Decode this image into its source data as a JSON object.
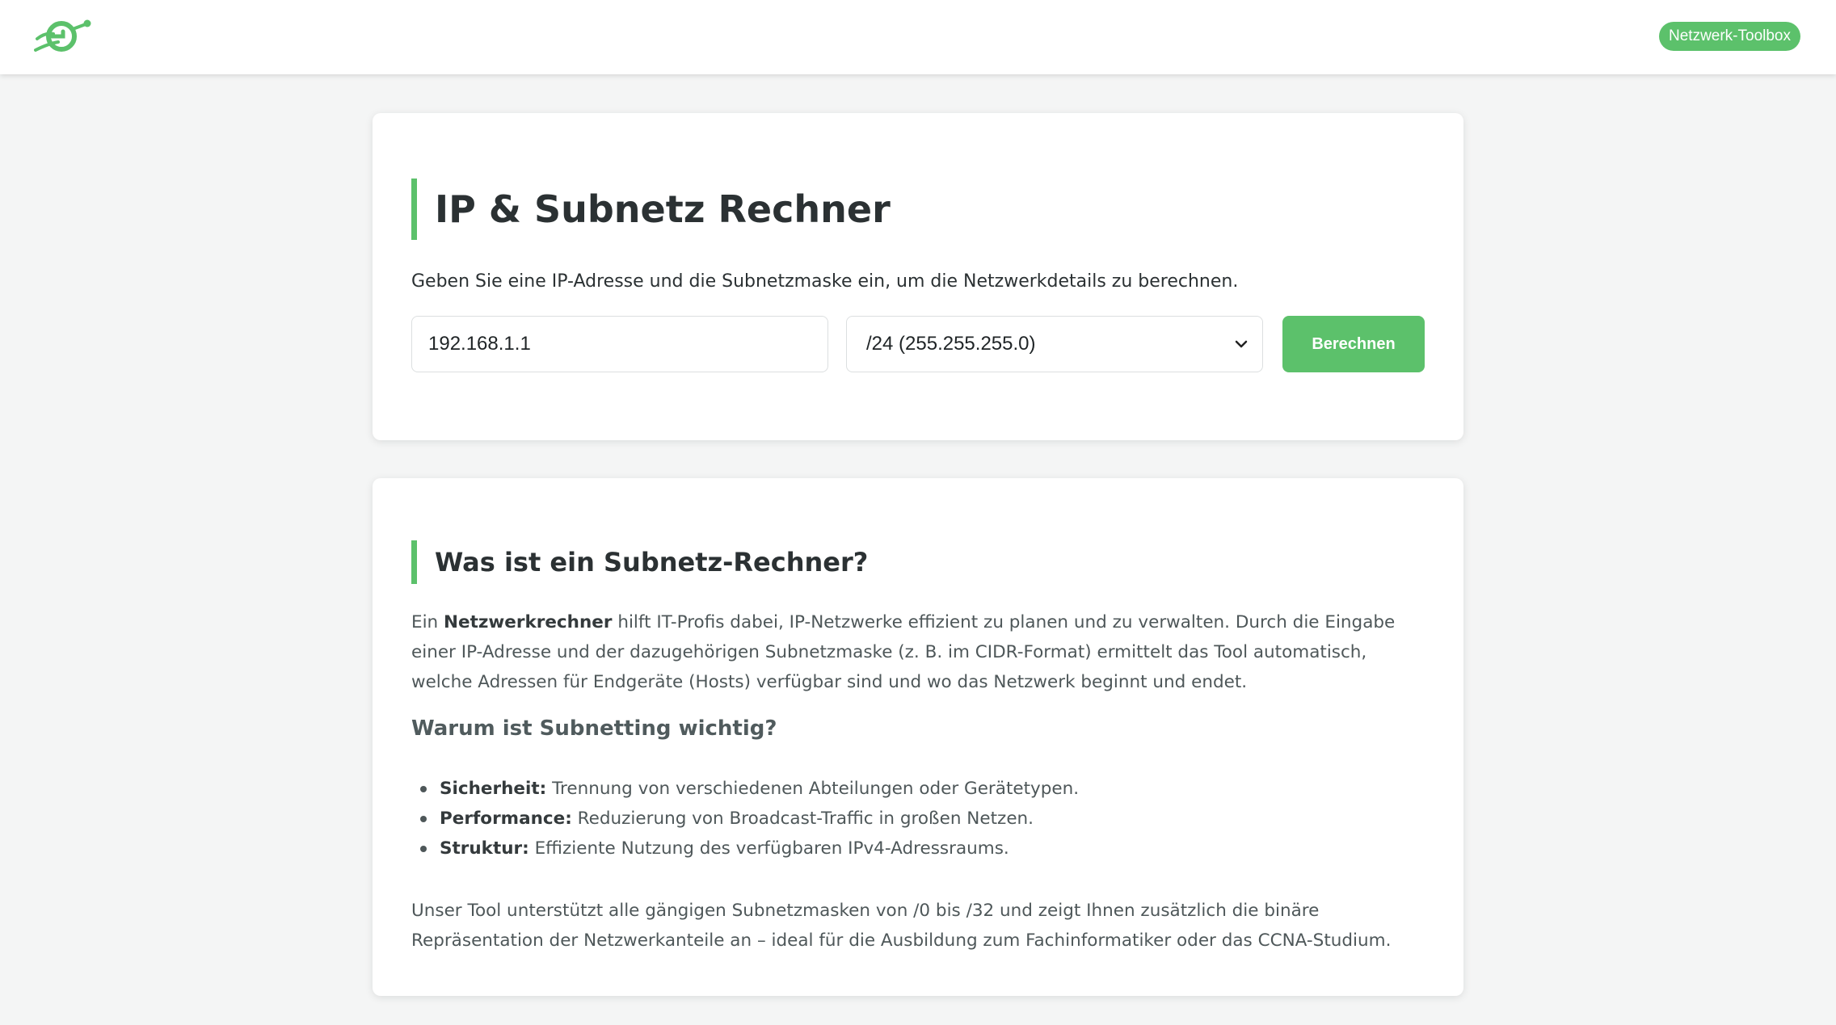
{
  "header": {
    "logo_icon": "network-target-logo",
    "badge_label": "Netzwerk-Toolbox"
  },
  "calculator": {
    "title": "IP & Subnetz Rechner",
    "description": "Geben Sie eine IP-Adresse und die Subnetzmaske ein, um die Netzwerkdetails zu berechnen.",
    "ip_value": "192.168.1.1",
    "cidr_selected": "/24 (255.255.255.0)",
    "calculate_label": "Berechnen"
  },
  "info": {
    "title": "Was ist ein Subnetz-Rechner?",
    "intro_prefix": "Ein ",
    "intro_bold": "Netzwerkrechner",
    "intro_rest": " hilft IT-Profis dabei, IP-Netzwerke effizient zu planen und zu verwalten. Durch die Eingabe einer IP-Adresse und der dazugehörigen Subnetzmaske (z. B. im CIDR-Format) ermittelt das Tool automatisch, welche Adressen für Endgeräte (Hosts) verfügbar sind und wo das Netzwerk beginnt und endet.",
    "subheading": "Warum ist Subnetting wichtig?",
    "bullets": [
      {
        "term": "Sicherheit:",
        "text": " Trennung von verschiedenen Abteilungen oder Gerätetypen."
      },
      {
        "term": "Performance:",
        "text": " Reduzierung von Broadcast-Traffic in großen Netzen."
      },
      {
        "term": "Struktur:",
        "text": " Effiziente Nutzung des verfügbaren IPv4-Adressraums."
      }
    ],
    "outro": "Unser Tool unterstützt alle gängigen Subnetzmasken von /0 bis /32 und zeigt Ihnen zusätzlich die binäre Repräsentation der Netzwerkanteile an – ideal für die Ausbildung zum Fachinformatiker oder das CCNA-Studium."
  },
  "colors": {
    "accent": "#5cc16b",
    "background": "#f4f5f5",
    "card": "#ffffff"
  }
}
